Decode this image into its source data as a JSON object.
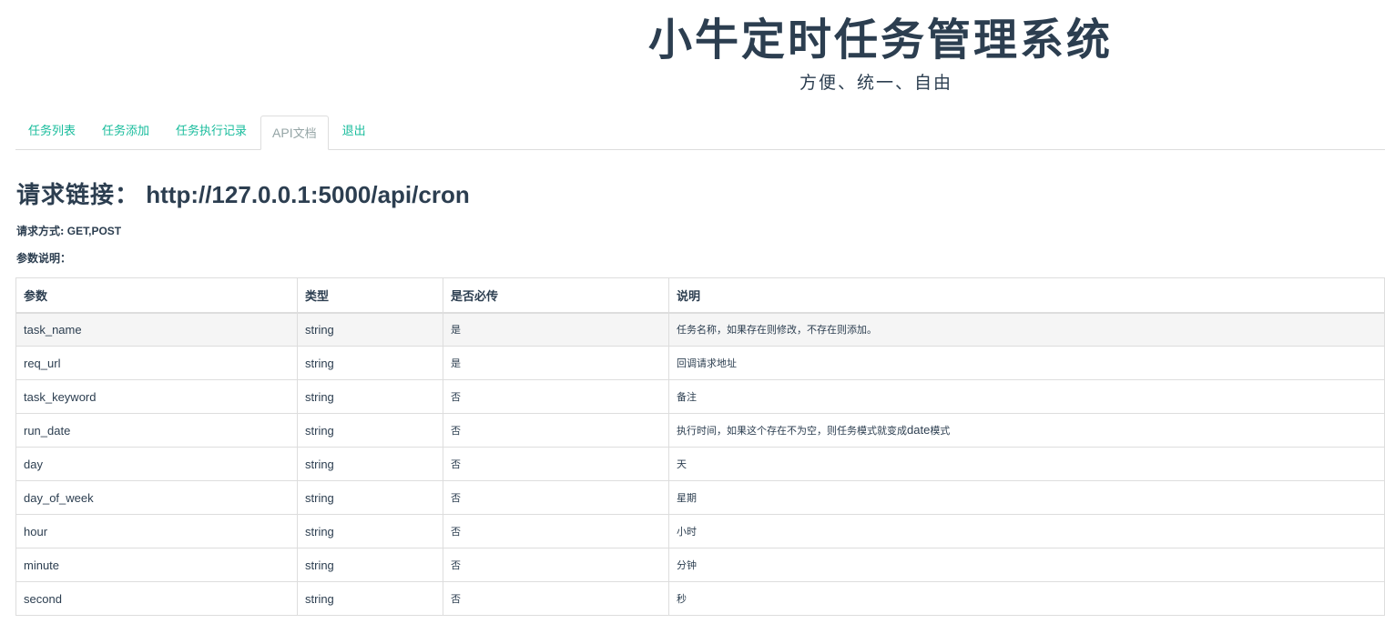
{
  "header": {
    "title": "小牛定时任务管理系统",
    "subtitle": "方便、统一、自由"
  },
  "tabs": [
    {
      "label": "任务列表",
      "active": false
    },
    {
      "label": "任务添加",
      "active": false
    },
    {
      "label": "任务执行记录",
      "active": false
    },
    {
      "label_latin": "API",
      "label_cjk": "文档",
      "active": true
    },
    {
      "label": "退出",
      "active": false
    }
  ],
  "request": {
    "url_label": "请求链接：",
    "url": "http://127.0.0.1:5000/api/cron",
    "method_label": "请求方式:",
    "method": "GET,POST",
    "params_title": "参数说明："
  },
  "table": {
    "headers": [
      "参数",
      "类型",
      "是否必传",
      "说明"
    ],
    "rows": [
      {
        "param": "task_name",
        "type": "string",
        "required": "是",
        "desc": "任务名称，如果存在则修改，不存在则添加。"
      },
      {
        "param": "req_url",
        "type": "string",
        "required": "是",
        "desc": "回调请求地址"
      },
      {
        "param": "task_keyword",
        "type": "string",
        "required": "否",
        "desc": "备注"
      },
      {
        "param": "run_date",
        "type": "string",
        "required": "否",
        "desc_a": "执行时间，如果这个存在不为空，则任务模式就变成",
        "desc_b": "date",
        "desc_c": "模式"
      },
      {
        "param": "day",
        "type": "string",
        "required": "否",
        "desc": "天"
      },
      {
        "param": "day_of_week",
        "type": "string",
        "required": "否",
        "desc": "星期"
      },
      {
        "param": "hour",
        "type": "string",
        "required": "否",
        "desc": "小时"
      },
      {
        "param": "minute",
        "type": "string",
        "required": "否",
        "desc": "分钟"
      },
      {
        "param": "second",
        "type": "string",
        "required": "否",
        "desc": "秒"
      }
    ]
  },
  "colors": {
    "text": "#2c3e50",
    "link": "#18bc9c",
    "active_tab": "#95a5a6",
    "border": "#dddddd",
    "row_highlight": "#f5f5f5"
  }
}
